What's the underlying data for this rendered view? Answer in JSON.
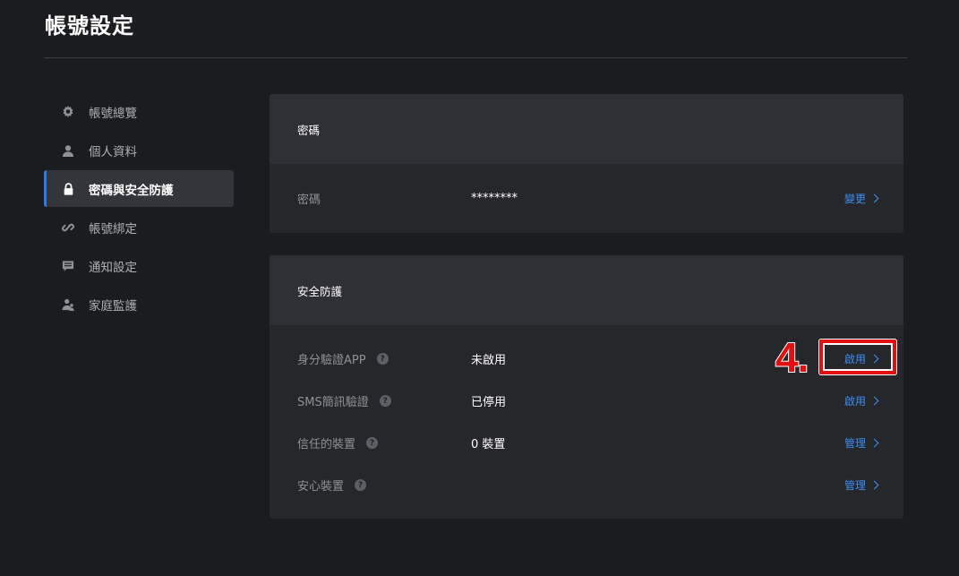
{
  "page": {
    "title": "帳號設定"
  },
  "sidebar": {
    "items": [
      {
        "label": "帳號總覽",
        "icon": "gear-icon",
        "active": false
      },
      {
        "label": "個人資料",
        "icon": "user-icon",
        "active": false
      },
      {
        "label": "密碼與安全防護",
        "icon": "lock-icon",
        "active": true
      },
      {
        "label": "帳號綁定",
        "icon": "link-icon",
        "active": false
      },
      {
        "label": "通知設定",
        "icon": "message-icon",
        "active": false
      },
      {
        "label": "家庭監護",
        "icon": "family-icon",
        "active": false
      }
    ]
  },
  "password_card": {
    "header": "密碼",
    "rows": [
      {
        "label": "密碼",
        "value": "********",
        "action": "變更"
      }
    ]
  },
  "security_card": {
    "header": "安全防護",
    "rows": [
      {
        "label": "身分驗證APP",
        "value": "未啟用",
        "action": "啟用"
      },
      {
        "label": "SMS簡訊驗證",
        "value": "已停用",
        "action": "啟用"
      },
      {
        "label": "信任的裝置",
        "value": "0 裝置",
        "action": "管理"
      },
      {
        "label": "安心裝置",
        "value": "",
        "action": "管理"
      }
    ]
  },
  "annotation": {
    "step": "4.",
    "color": "#e01010"
  },
  "colors": {
    "accent": "#2e7ae6",
    "link": "#3d8ef5",
    "background": "#1b1c1f",
    "card": "#26272b"
  }
}
